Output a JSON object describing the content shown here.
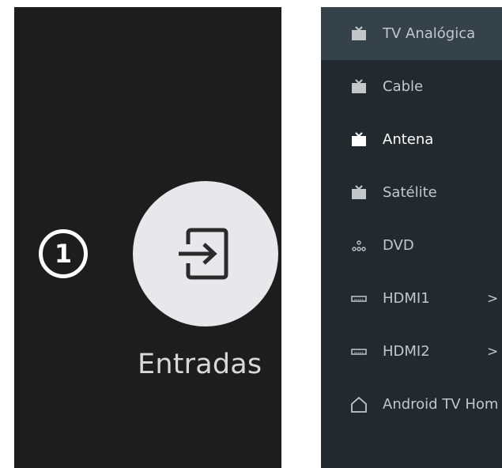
{
  "left_panel": {
    "step_number": "1",
    "inputs_label": "Entradas"
  },
  "menu": {
    "items": [
      {
        "label": "TV Analógica",
        "icon": "tv-icon"
      },
      {
        "label": "Cable",
        "icon": "tv-icon"
      },
      {
        "label": "Antena",
        "icon": "tv-icon"
      },
      {
        "label": "Satélite",
        "icon": "tv-icon"
      },
      {
        "label": "DVD",
        "icon": "dvd-icon"
      },
      {
        "label": "HDMI1",
        "icon": "hdmi-icon",
        "arrow": ">"
      },
      {
        "label": "HDMI2",
        "icon": "hdmi-icon",
        "arrow": ">"
      },
      {
        "label": "Android TV Hom",
        "icon": "home-icon"
      }
    ]
  },
  "colors": {
    "left_panel_bg": "#1d1d1d",
    "right_panel_bg": "#222a30",
    "highlight_bg": "#36424a",
    "inputs_circle": "#e8e8ea",
    "menu_text": "#c3c7ca",
    "active_text": "#ffffff"
  }
}
